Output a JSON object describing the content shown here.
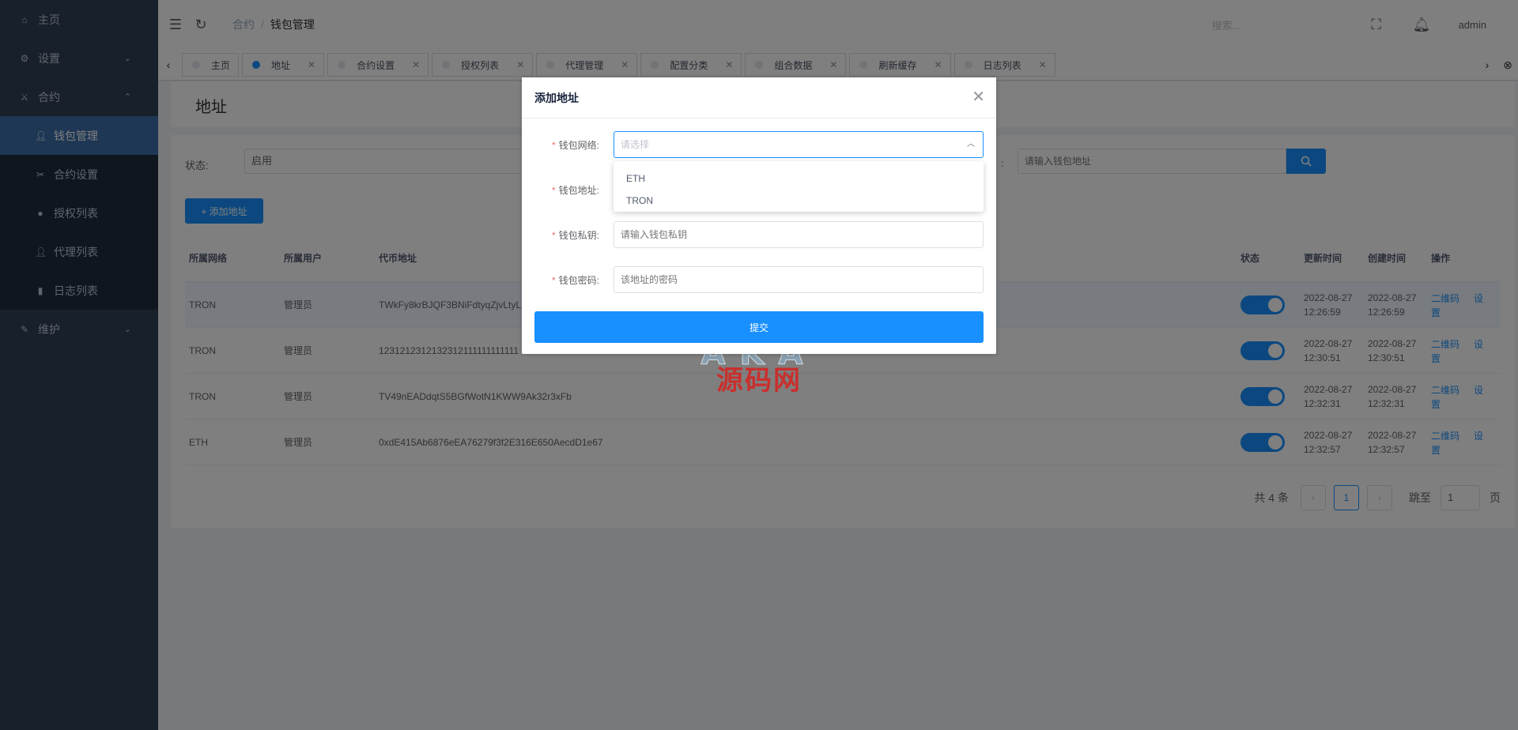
{
  "sidebar": {
    "items": [
      {
        "label": "主页",
        "icon": "home-icon"
      },
      {
        "label": "设置",
        "icon": "gear-icon"
      },
      {
        "label": "合约",
        "icon": "contract-icon"
      },
      {
        "label": "维护",
        "icon": "wrench-icon"
      }
    ],
    "sub": [
      {
        "label": "钱包管理",
        "icon": "user-icon"
      },
      {
        "label": "合约设置",
        "icon": "tools-icon"
      },
      {
        "label": "授权列表",
        "icon": "circle-icon"
      },
      {
        "label": "代理列表",
        "icon": "user-icon"
      },
      {
        "label": "日志列表",
        "icon": "book-icon"
      }
    ]
  },
  "header": {
    "breadcrumb": [
      "合约",
      "钱包管理"
    ],
    "search_placeholder": "搜索...",
    "user": "admin"
  },
  "tags": [
    "主页",
    "地址",
    "合约设置",
    "授权列表",
    "代理管理",
    "配置分类",
    "组合数据",
    "刷新缓存",
    "日志列表"
  ],
  "page": {
    "title": "地址",
    "filter_label": "状态:",
    "filter_value": "启用",
    "filter_colon": ":",
    "address_placeholder": "请输入钱包地址",
    "add_button": "+ 添加地址"
  },
  "table": {
    "headers": [
      "所属网络",
      "所属用户",
      "代币地址",
      "状态",
      "更新时间",
      "创建时间",
      "操作"
    ],
    "rows": [
      {
        "network": "TRON",
        "user": "管理员",
        "address": "TWkFy8krBJQF3BNiFdtyqZjvLtyL",
        "status": true,
        "updated": [
          "2022-08-27",
          "12:26:59"
        ],
        "created": [
          "2022-08-27",
          "12:26:59"
        ]
      },
      {
        "network": "TRON",
        "user": "管理员",
        "address": "1231212312132312111111111111",
        "status": true,
        "updated": [
          "2022-08-27",
          "12:30:51"
        ],
        "created": [
          "2022-08-27",
          "12:30:51"
        ]
      },
      {
        "network": "TRON",
        "user": "管理员",
        "address": "TV49nEADdqtS5BGfWotN1KWW9Ak32r3xFb",
        "status": true,
        "updated": [
          "2022-08-27",
          "12:32:31"
        ],
        "created": [
          "2022-08-27",
          "12:32:31"
        ]
      },
      {
        "network": "ETH",
        "user": "管理员",
        "address": "0xdE415Ab6876eEA76279f3f2E316E650AecdD1e67",
        "status": true,
        "updated": [
          "2022-08-27",
          "12:32:57"
        ],
        "created": [
          "2022-08-27",
          "12:32:57"
        ]
      }
    ],
    "action_qr": [
      "二维码",
      "二维码",
      "二维码",
      "二维码"
    ],
    "action_qr_wrap": "置",
    "action_set": "设"
  },
  "pager": {
    "total": "共 4 条",
    "current": "1",
    "goto_label": "跳至",
    "goto_value": "1",
    "page_suffix": "页"
  },
  "dialog": {
    "title": "添加地址",
    "fields": [
      {
        "label": "钱包网络:",
        "placeholder": "请选择"
      },
      {
        "label": "钱包地址:",
        "placeholder": ""
      },
      {
        "label": "钱包私钥:",
        "placeholder": "请输入钱包私钥"
      },
      {
        "label": "钱包密码:",
        "placeholder": "该地址的密码"
      }
    ],
    "required_mark": "*",
    "options": [
      "ETH",
      "TRON"
    ],
    "submit": "提交"
  },
  "watermark": {
    "top": "AKA",
    "bottom": "源码网"
  },
  "colors": {
    "primary": "#1890ff",
    "sidebar": "#304156",
    "sidebar_active": "#3d6fa9",
    "required": "#f56c6c"
  }
}
